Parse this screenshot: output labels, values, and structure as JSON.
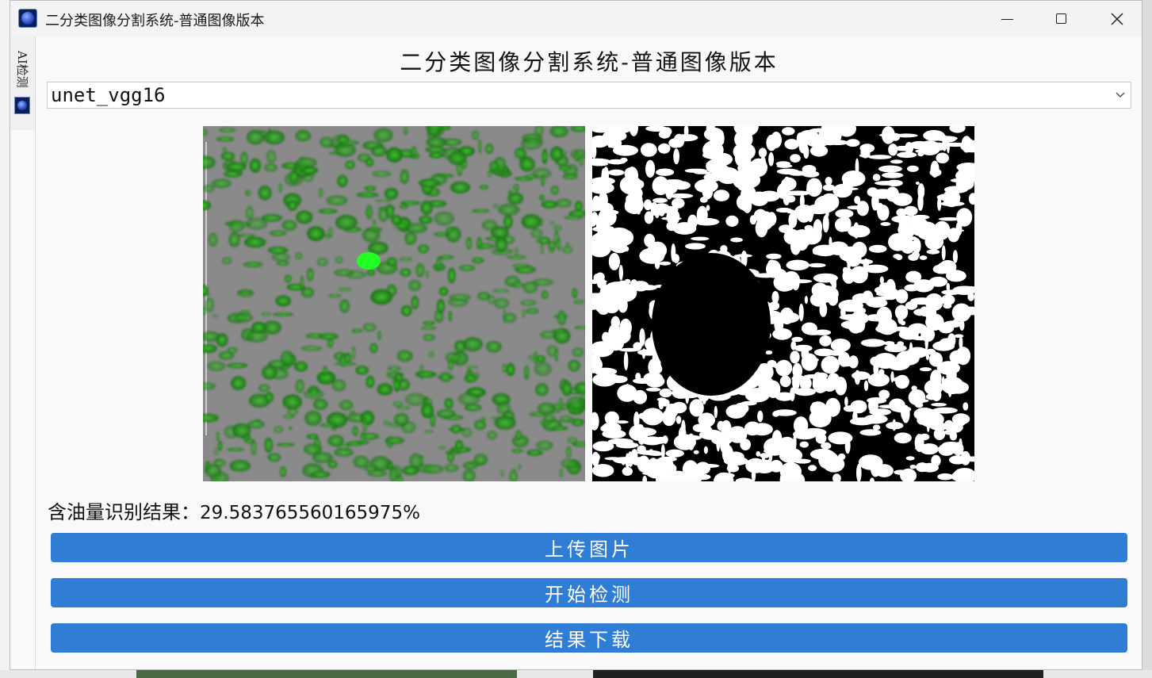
{
  "window": {
    "title": "二分类图像分割系统-普通图像版本",
    "minimize_icon": "minimize-icon",
    "maximize_icon": "maximize-icon",
    "close_icon": "close-icon"
  },
  "side_tab": {
    "label": "AI检测"
  },
  "main": {
    "heading": "二分类图像分割系统-普通图像版本",
    "model_select": {
      "selected": "unet_vgg16"
    },
    "result": {
      "label": "含油量识别结果：",
      "value": "29.583765560165975%"
    },
    "buttons": {
      "upload": "上传图片",
      "detect": "开始检测",
      "download": "结果下载"
    }
  },
  "colors": {
    "button_bg": "#2f7dd4",
    "input_image_bg": "#8a8a8a",
    "input_image_green": "#1f8a1a",
    "result_image_bg": "#000000",
    "result_image_fg": "#ffffff"
  }
}
